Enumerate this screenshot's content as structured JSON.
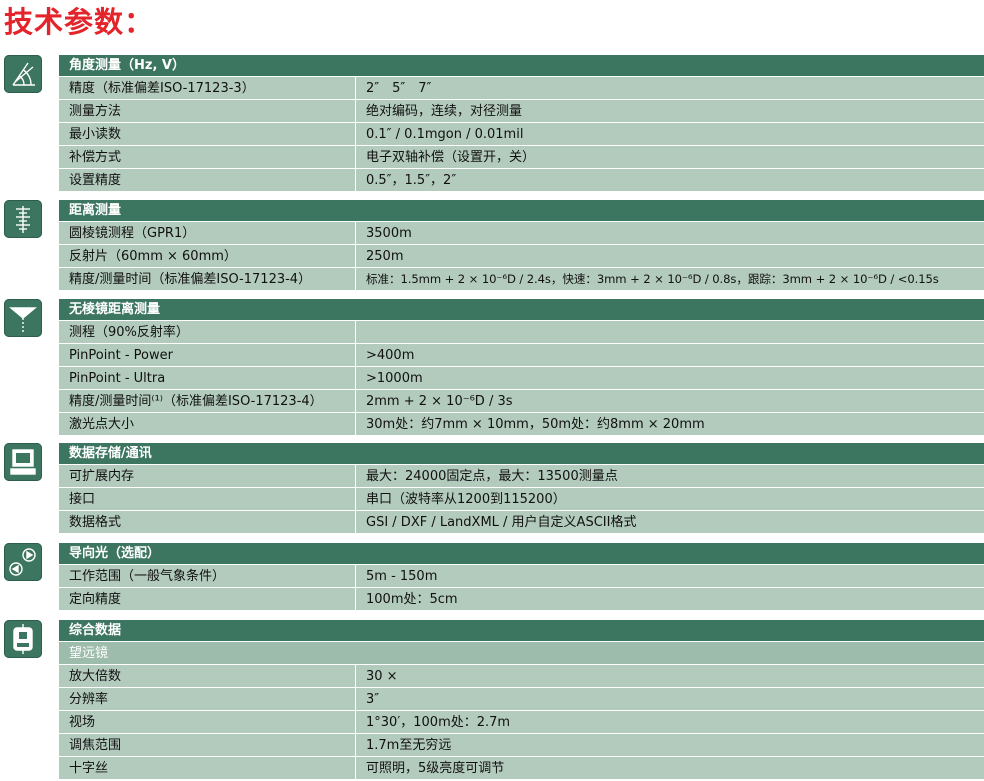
{
  "page_title": "技术参数：",
  "colors": {
    "title": "#e3242b",
    "header": "#3c7661",
    "row": "#b3cbbd",
    "subheader": "#9dbcab"
  },
  "sections": [
    {
      "icon": "angle-measurement-icon",
      "header": "角度测量（Hz, V）",
      "rows": [
        {
          "k": "精度（标准偏差ISO-17123-3）",
          "v": "2″　5″　7″"
        },
        {
          "k": "测量方法",
          "v": "绝对编码，连续，对径测量"
        },
        {
          "k": "最小读数",
          "v": "0.1″ / 0.1mgon / 0.01mil"
        },
        {
          "k": "补偿方式",
          "v": "电子双轴补偿（设置开，关）"
        },
        {
          "k": "设置精度",
          "v": "0.5″，1.5″，2″"
        }
      ]
    },
    {
      "icon": "distance-measurement-icon",
      "header": "距离测量",
      "rows": [
        {
          "k": "圆棱镜测程（GPR1）",
          "v": "3500m"
        },
        {
          "k": "反射片（60mm × 60mm）",
          "v": "250m"
        },
        {
          "k": "精度/测量时间（标准偏差ISO-17123-4）",
          "v": "标准：1.5mm + 2 × 10⁻⁶D / 2.4s，快速：3mm + 2 × 10⁻⁶D / 0.8s，跟踪：3mm + 2 × 10⁻⁶D / <0.15s"
        }
      ]
    },
    {
      "icon": "reflectorless-laser-icon",
      "header": "无棱镜距离测量",
      "sub": "测程（90%反射率）",
      "rows": [
        {
          "k": "PinPoint - Power",
          "v": ">400m"
        },
        {
          "k": "PinPoint - Ultra",
          "v": ">1000m"
        },
        {
          "k": "精度/测量时间⁽¹⁾（标准偏差ISO-17123-4）",
          "v": "2mm + 2 × 10⁻⁶D / 3s"
        },
        {
          "k": "激光点大小",
          "v": "30m处：约7mm × 10mm，50m处：约8mm × 20mm"
        }
      ]
    },
    {
      "icon": "computer-monitor-icon",
      "header": "数据存储/通讯",
      "rows": [
        {
          "k": "可扩展内存",
          "v": "最大：24000固定点，最大：13500测量点"
        },
        {
          "k": "接口",
          "v": "串口（波特率从1200到115200）"
        },
        {
          "k": "数据格式",
          "v": "GSI / DXF / LandXML / 用户自定义ASCII格式"
        }
      ]
    },
    {
      "icon": "guide-light-icon",
      "header": "导向光（选配）",
      "rows": [
        {
          "k": "工作范围（一般气象条件）",
          "v": "5m - 150m"
        },
        {
          "k": "定向精度",
          "v": "100m处：5cm"
        }
      ]
    },
    {
      "icon": "total-station-icon",
      "header": "综合数据",
      "sub": "望远镜",
      "rows": [
        {
          "k": "放大倍数",
          "v": "30 ×"
        },
        {
          "k": "分辨率",
          "v": "3″"
        },
        {
          "k": "视场",
          "v": "1°30′，100m处：2.7m"
        },
        {
          "k": "调焦范围",
          "v": "1.7m至无穷远"
        },
        {
          "k": "十字丝",
          "v": "可照明，5级亮度可调节"
        }
      ]
    }
  ]
}
